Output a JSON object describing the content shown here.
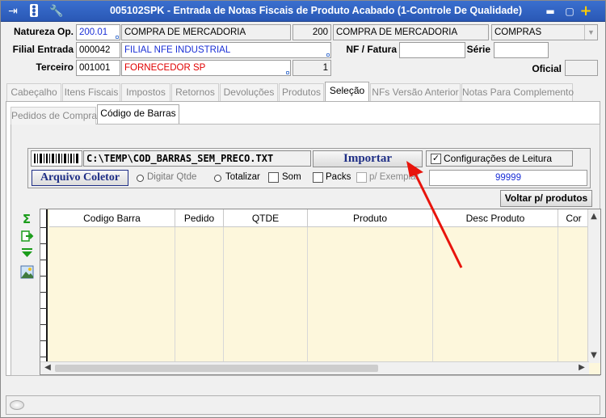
{
  "title": "005102SPK - Entrada de Notas Fiscais de Produto Acabado (1-Controle De Qualidade)",
  "header": {
    "natureza_label": "Natureza Op.",
    "natureza_code": "200.01",
    "natureza_desc": "COMPRA DE MERCADORIA",
    "natureza_num": "200",
    "natureza_desc2": "COMPRA DE MERCADORIA",
    "natureza_type": "COMPRAS",
    "filial_label": "Filial Entrada",
    "filial_code": "000042",
    "filial_name": "FILIAL NFE INDUSTRIAL",
    "terceiro_label": "Terceiro",
    "terceiro_code": "001001",
    "terceiro_name": "FORNECEDOR SP",
    "terceiro_num": "1",
    "nf_label": "NF / Fatura",
    "serie_label": "Série",
    "oficial_label": "Oficial"
  },
  "tabs": [
    "Cabeçalho",
    "Itens Fiscais",
    "Impostos",
    "Retornos",
    "Devoluções",
    "Produtos",
    "Seleção",
    "NFs Versão Anterior",
    "Notas Para Complemento"
  ],
  "subtabs": [
    "Pedidos de Compra",
    "Código de Barras"
  ],
  "toolbar": {
    "file_path": "C:\\TEMP\\COD_BARRAS_SEM_PRECO.TXT",
    "import_label": "Importar",
    "config_label": "Configurações de Leitura",
    "coletor_label": "Arquivo Coletor",
    "digitar_label": "Digitar Qtde",
    "totalizar_label": "Totalizar",
    "som_label": "Som",
    "packs_label": "Packs",
    "exemplar_label": "p/ Exemplar",
    "qty_value": "99999",
    "voltar_label": "Voltar p/ produtos"
  },
  "grid": {
    "columns": [
      "Codigo Barra",
      "Pedido",
      "QTDE",
      "Produto",
      "Desc Produto",
      "Cor"
    ]
  },
  "colors": {
    "titlebar": "#2a58b5",
    "grid_bg": "#fdf7dc",
    "arrow": "#e8140c",
    "blue_text": "#1a2fd6",
    "red_text": "#e00000"
  }
}
